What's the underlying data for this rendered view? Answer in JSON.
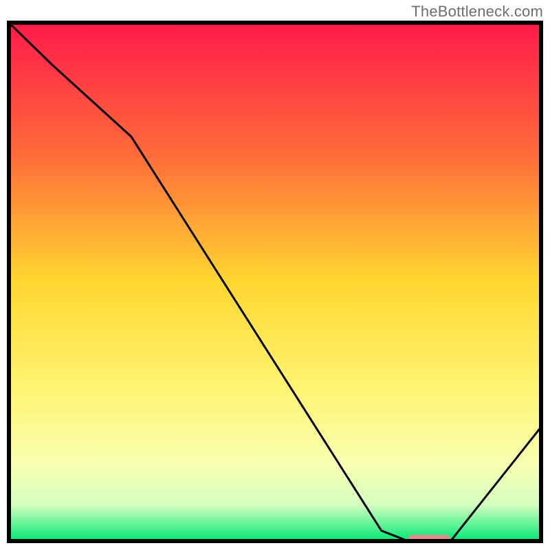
{
  "watermark": "TheBottleneck.com",
  "chart_data": {
    "type": "line",
    "title": "",
    "xlabel": "",
    "ylabel": "",
    "xlim": [
      0,
      100
    ],
    "ylim": [
      0,
      100
    ],
    "x": [
      0,
      8,
      23,
      70,
      75,
      83,
      100
    ],
    "values": [
      100,
      92,
      78,
      2,
      0,
      0,
      22
    ],
    "marker": {
      "x_range": [
        75,
        83
      ],
      "y": 0,
      "color": "#e78a8f"
    },
    "background_gradient": {
      "type": "vertical",
      "stops": [
        {
          "pos": 0.0,
          "color": "#ff1a4a"
        },
        {
          "pos": 0.25,
          "color": "#ff6a3a"
        },
        {
          "pos": 0.5,
          "color": "#ffd730"
        },
        {
          "pos": 0.7,
          "color": "#fff470"
        },
        {
          "pos": 0.85,
          "color": "#f8ffb0"
        },
        {
          "pos": 0.93,
          "color": "#d4ffc0"
        },
        {
          "pos": 1.0,
          "color": "#00e874"
        }
      ]
    },
    "line_style": {
      "color": "#000000",
      "width": 2
    }
  }
}
